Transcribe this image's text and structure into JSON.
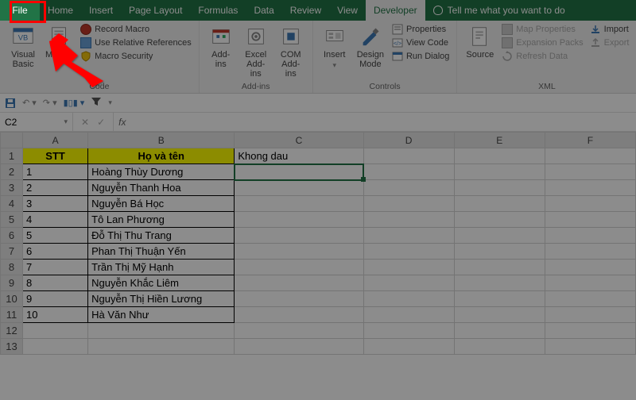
{
  "tabs": {
    "file": "File",
    "items": [
      "Home",
      "Insert",
      "Page Layout",
      "Formulas",
      "Data",
      "Review",
      "View",
      "Developer"
    ],
    "active": "Developer",
    "tell": "Tell me what you want to do"
  },
  "ribbon": {
    "code": {
      "visual_basic": "Visual\nBasic",
      "macros": "Macros",
      "record": "Record Macro",
      "relative": "Use Relative References",
      "security": "Macro Security",
      "label": "Code"
    },
    "addins": {
      "addins": "Add-\nins",
      "excel": "Excel\nAdd-ins",
      "com": "COM\nAdd-ins",
      "label": "Add-ins"
    },
    "controls": {
      "insert": "Insert",
      "design": "Design\nMode",
      "properties": "Properties",
      "view_code": "View Code",
      "run_dialog": "Run Dialog",
      "label": "Controls"
    },
    "xml": {
      "source": "Source",
      "map": "Map Properties",
      "expansion": "Expansion Packs",
      "refresh": "Refresh Data",
      "import": "Import",
      "export": "Export",
      "label": "XML"
    }
  },
  "namebox": "C2",
  "fx": "fx",
  "columns": [
    "A",
    "B",
    "C",
    "D",
    "E",
    "F"
  ],
  "headers": {
    "a": "STT",
    "b": "Họ và tên",
    "c": "Khong dau"
  },
  "rows": [
    {
      "n": "1",
      "name": "Hoàng Thùy Dương"
    },
    {
      "n": "2",
      "name": "Nguyễn Thanh Hoa"
    },
    {
      "n": "3",
      "name": "Nguyễn Bá Học"
    },
    {
      "n": "4",
      "name": "Tô Lan Phương"
    },
    {
      "n": "5",
      "name": "Đỗ Thị Thu Trang"
    },
    {
      "n": "6",
      "name": "Phan Thị Thuận Yến"
    },
    {
      "n": "7",
      "name": "Trần Thị Mỹ Hạnh"
    },
    {
      "n": "8",
      "name": "Nguyễn Khắc Liêm"
    },
    {
      "n": "9",
      "name": "Nguyễn Thị Hiền Lương"
    },
    {
      "n": "10",
      "name": "Hà Văn Như"
    }
  ]
}
